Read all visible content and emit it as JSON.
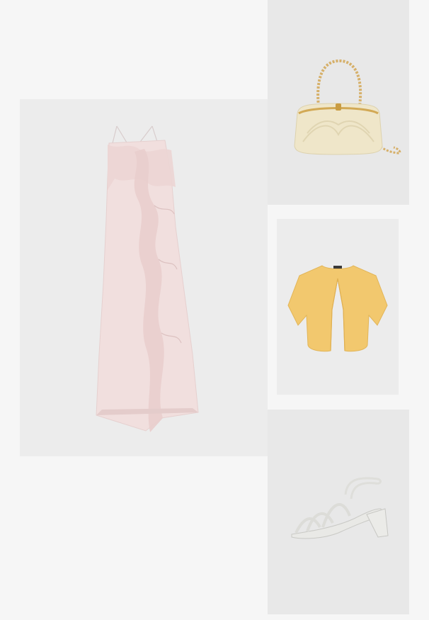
{
  "outfit": {
    "items": [
      {
        "name": "dress",
        "icon": "ruffle-slip-dress-image",
        "color": "#f0dedd"
      },
      {
        "name": "handbag",
        "icon": "pearl-clutch-bag-image",
        "color": "#efe6c9"
      },
      {
        "name": "cardigan",
        "icon": "short-sleeve-cardigan-image",
        "color": "#f2c86e"
      },
      {
        "name": "sandals",
        "icon": "strappy-block-heel-sandal-image",
        "color": "#e9e9e6"
      }
    ]
  }
}
